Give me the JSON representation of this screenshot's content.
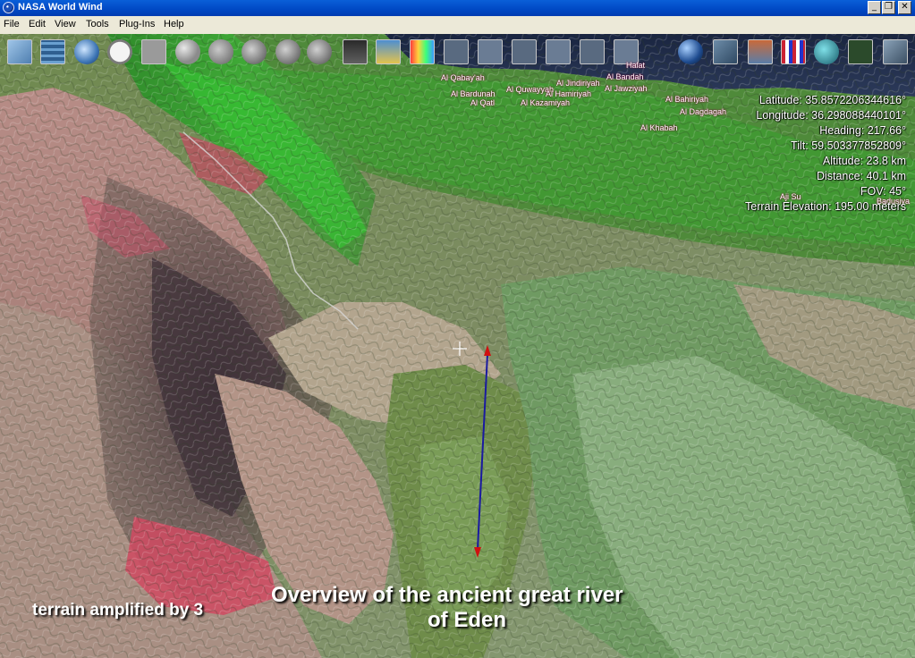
{
  "window": {
    "title": "NASA World Wind",
    "controls": [
      "_",
      "❐",
      "✕"
    ]
  },
  "menu": [
    "File",
    "Edit",
    "View",
    "Tools",
    "Plug-Ins",
    "Help"
  ],
  "toolbar": {
    "icons": [
      "layer-manager-icon",
      "grid-lines-icon",
      "globe-lines-icon",
      "time-icon",
      "screenshot-icon",
      "search-icon",
      "place-finder-icon",
      "globe-icon",
      "globe-icon",
      "globe-icon",
      "modis-layer-icon",
      "wms-layer-icon",
      "colorbar-icon",
      "layer-preset-icon",
      "layer-preset-icon",
      "layer-preset-icon",
      "layer-preset-icon",
      "layer-preset-icon",
      "layer-preset-icon",
      "planet-icon",
      "landsat-icon",
      "boundaries-icon",
      "flags-icon",
      "world-view-icon",
      "usa-map-icon",
      "compass-icon"
    ]
  },
  "placenames": [
    "Al Qabay'ah",
    "Al Bardunah",
    "Al Jindiriyah",
    "Al Bandah",
    "Al Jawziyah",
    "Al Qatl",
    "Al Kazamiyah",
    "Al Bahiriyah",
    "Al Quwayyah",
    "Al Dagdagah",
    "Al Khabah",
    "Aji Su",
    "Badusiya",
    "Halat",
    "Al Hamiriyah"
  ],
  "status": {
    "latitude": "Latitude: 35.8572206344616°",
    "longitude": "Longitude: 36.298088440101°",
    "heading": "Heading: 217.66°",
    "tilt": "Tilt: 59.503377852809°",
    "altitude": "Altitude: 23.8 km",
    "distance": "Distance: 40.1 km",
    "fov": "FOV: 45°",
    "terrain_elevation": "Terrain Elevation: 195.00 meters"
  },
  "captions": {
    "terrain_note": "terrain amplified by 3",
    "title_line1": "Overview of the ancient great river",
    "title_line2": "of Eden"
  },
  "colors": {
    "title_bar": "#0a5fd8",
    "arrow_line": "#1a1aa0",
    "arrow_head": "#d01010",
    "placename_shadow": "#7a0033"
  }
}
